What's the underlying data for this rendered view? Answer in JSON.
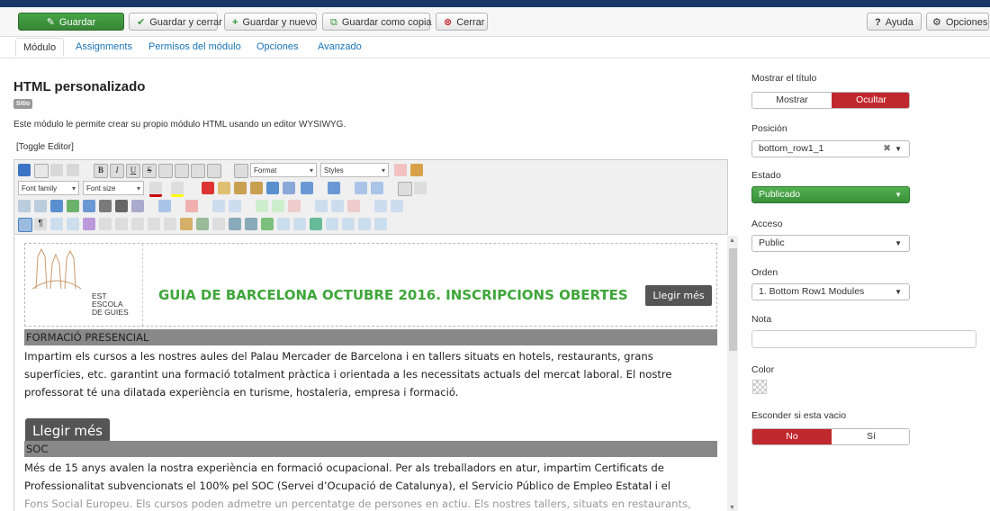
{
  "toolbar": {
    "save": "Guardar",
    "save_close": "Guardar y cerrar",
    "save_new": "Guardar y nuevo",
    "save_copy": "Guardar como copia",
    "close": "Cerrar",
    "help": "Ayuda",
    "options": "Opciones"
  },
  "tabs": [
    "Módulo",
    "Assignments",
    "Permisos del módulo",
    "Opciones",
    "Avanzado"
  ],
  "module": {
    "title": "HTML personalizado",
    "badge": "Sitio",
    "description": "Este módulo le permite crear su propio módulo HTML usando un editor WYSIWYG.",
    "toggle_editor": "[Toggle Editor]"
  },
  "editor": {
    "format_label": "Format",
    "styles_label": "Styles",
    "font_family_label": "Font family",
    "font_size_label": "Font size"
  },
  "content": {
    "logo_text": [
      "EST",
      "ESCOLA",
      "DE GUIES"
    ],
    "headline": "GUIA DE BARCELONA OCTUBRE 2016. INSCRIPCIONS OBERTES",
    "read_more": "Llegir més",
    "section1_title": "FORMACIÓ PRESENCIAL",
    "section1_lines": [
      "Impartim els cursos a les nostres aules del Palau Mercader de Barcelona i en tallers situats en hotels, restaurants,  grans",
      "superfícies, etc. garantint una formació totalment pràctica i orientada a les necessitats actuals del mercat laboral. El nostre",
      "professorat té una dilatada experiència en turisme, hostaleria, empresa i formació."
    ],
    "read_more_big": "Llegir més",
    "section2_title": "SOC",
    "section2_lines": [
      "Més de 15 anys avalen la nostra experiència en formació ocupacional.  Per als treballadors en atur, impartim  Certificats de",
      "Professionalitat subvencionats el 100% pel SOC (Servei d’Ocupació de Catalunya), el Servicio Público de Empleo Estatal  i el",
      "Fons Social Europeu.  Els cursos poden admetre un percentatge de persones en actiu. Els nostres tallers, situats en restaurants,"
    ]
  },
  "sidebar": {
    "show_title_label": "Mostrar el título",
    "show": "Mostrar",
    "hide": "Ocultar",
    "position_label": "Posición",
    "position_value": "bottom_row1_1",
    "state_label": "Estado",
    "state_value": "Publicado",
    "access_label": "Acceso",
    "access_value": "Public",
    "order_label": "Orden",
    "order_value": "1. Bottom Row1 Modules",
    "note_label": "Nota",
    "color_label": "Color",
    "hide_empty_label": "Esconder si esta vacio",
    "no": "No",
    "yes": "Sí"
  },
  "colors": {
    "green": "#46a546",
    "red": "#c0282d",
    "headline_green": "#3fa63a",
    "section_bar": "#888888",
    "link_blue": "#1a73b5"
  }
}
